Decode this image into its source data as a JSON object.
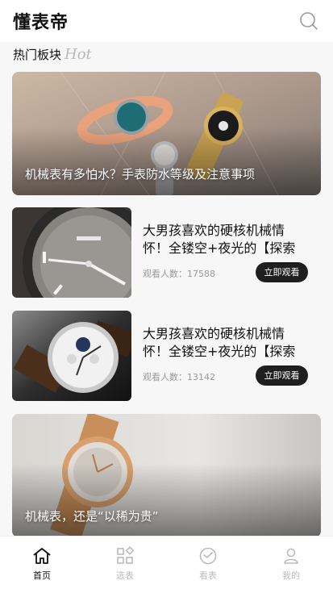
{
  "header": {
    "title": "懂表帝",
    "search_icon": "search-icon"
  },
  "section": {
    "title": "热门板块",
    "hot_label": "Hot"
  },
  "banners": [
    {
      "caption": "机械表有多怕水？手表防水等级及注意事项"
    },
    {
      "caption": "机械表，还是“以稀为贵”"
    }
  ],
  "articles": [
    {
      "title": "大男孩喜欢的硬核机械情怀！全镂空+夜光的【探索者】",
      "viewers_label": "观看人数：",
      "viewers": "17588",
      "button": "立即观看"
    },
    {
      "title": "大男孩喜欢的硬核机械情怀！全镂空+夜光的【探索者】",
      "viewers_label": "观看人数：",
      "viewers": "13142",
      "button": "立即观看"
    }
  ],
  "tabs": [
    {
      "label": "首页",
      "icon": "home-icon",
      "active": true
    },
    {
      "label": "选表",
      "icon": "grid-icon",
      "active": false
    },
    {
      "label": "看表",
      "icon": "watch-icon",
      "active": false
    },
    {
      "label": "我的",
      "icon": "user-icon",
      "active": false
    }
  ],
  "colors": {
    "active_tab": "#111111",
    "inactive_tab": "#bbbbbb",
    "button_bg": "#1f1f1f"
  }
}
